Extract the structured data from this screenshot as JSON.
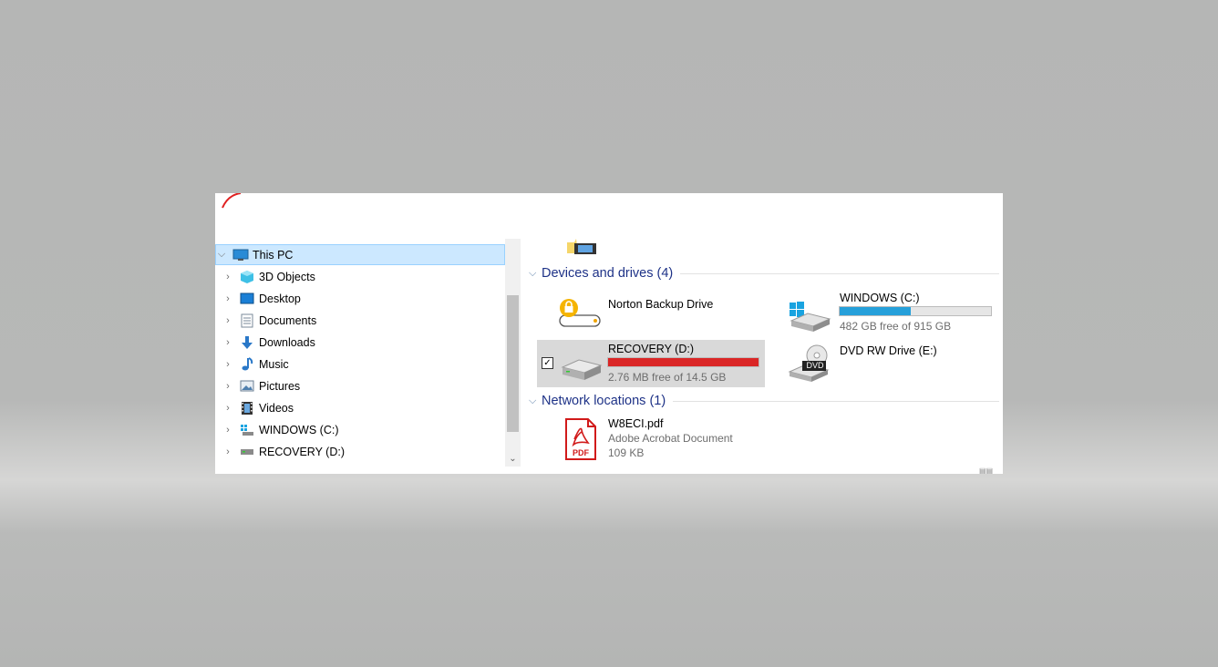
{
  "nav": {
    "items": [
      {
        "label": "This PC",
        "icon": "computer-icon"
      },
      {
        "label": "3D Objects",
        "icon": "cube-icon"
      },
      {
        "label": "Desktop",
        "icon": "desktop-icon"
      },
      {
        "label": "Documents",
        "icon": "document-icon"
      },
      {
        "label": "Downloads",
        "icon": "download-icon"
      },
      {
        "label": "Music",
        "icon": "music-icon"
      },
      {
        "label": "Pictures",
        "icon": "picture-icon"
      },
      {
        "label": "Videos",
        "icon": "video-icon"
      },
      {
        "label": "WINDOWS (C:)",
        "icon": "windows-drive-icon"
      },
      {
        "label": "RECOVERY (D:)",
        "icon": "drive-icon"
      }
    ]
  },
  "devices": {
    "header": "Devices and drives (4)",
    "norton": {
      "name": "Norton Backup Drive"
    },
    "windows_c": {
      "name": "WINDOWS (C:)",
      "space": "482 GB free of 915 GB",
      "used_fraction": 0.47
    },
    "recovery_d": {
      "name": "RECOVERY (D:)",
      "space": "2.76 MB free of 14.5 GB",
      "used_fraction": 0.999
    },
    "dvd_e": {
      "name": "DVD RW Drive (E:)",
      "badge": "DVD"
    }
  },
  "network": {
    "header": "Network locations (1)",
    "file": {
      "name": "W8ECI.pdf",
      "type": "Adobe Acrobat Document",
      "size": "109 KB",
      "badge": "PDF"
    }
  },
  "colors": {
    "accent_bar": "#26a0da",
    "full_bar": "#da2626",
    "selection": "#cce8ff",
    "header_text": "#1e3287"
  }
}
